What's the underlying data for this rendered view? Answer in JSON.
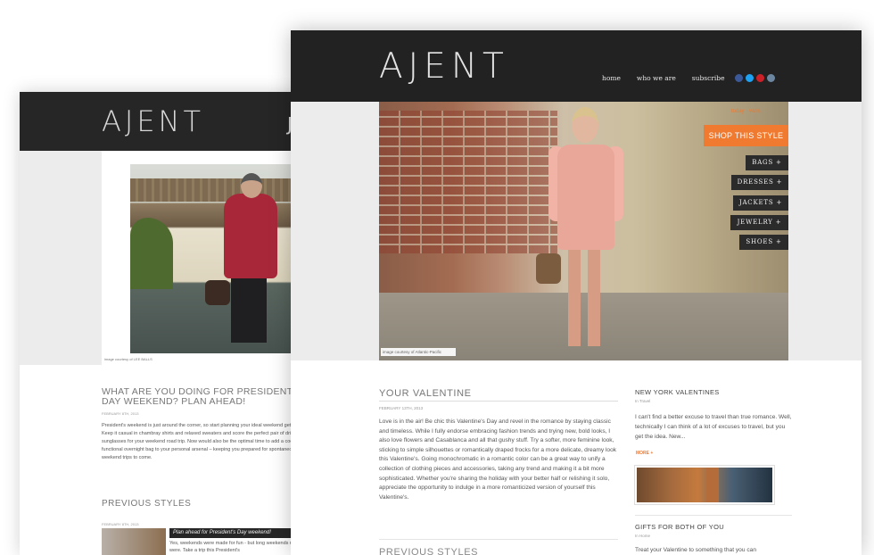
{
  "back_window": {
    "logo": "AJENT",
    "logo_tail": "J",
    "photo_credit": "image courtesy of LEE BALLS",
    "post": {
      "title": "WHAT ARE YOU DOING FOR PRESIDENT'S DAY WEEKEND? PLAN AHEAD!",
      "date": "FEBRUARY 8TH, 2013",
      "body": "President's weekend is just around the corner, so start planning your ideal weekend getaway. Keep it casual in chambray shirts and relaxed sweaters and score the perfect pair of driving sunglasses for your weekend road trip. Now would also be the optimal time to add a cool but functional overnight bag to your personal arsenal – keeping you prepared for spontaneous weekend trips to come."
    },
    "previous_styles": {
      "heading": "PREVIOUS STYLES",
      "date": "FEBRUARY 8TH, 2013",
      "item_title": "Plan ahead for President's Day weekend!",
      "item_body": "Yes, weekends were made for fun - but long weekends really were. Take a trip this President's"
    }
  },
  "front_window": {
    "logo": "AJENT",
    "nav": [
      "home",
      "who we are",
      "subscribe"
    ],
    "social_colors": [
      "#3b5998",
      "#1da1f2",
      "#cb2027",
      "#6c86a0"
    ],
    "hero": {
      "links": "today  ·  vans",
      "shop_button": "SHOP THIS STYLE",
      "categories": [
        "BAGS +",
        "DRESSES +",
        "JACKETS +",
        "JEWELRY +",
        "SHOES +"
      ],
      "credit": "image courtesy of Atlantic-Pacific"
    },
    "post": {
      "title": "YOUR VALENTINE",
      "date": "FEBRUARY 13TH, 2013",
      "body": "Love is in the air! Be chic this Valentine's Day and revel in the romance by staying classic and timeless. While I fully endorse embracing fashion trends and trying new, bold looks, I also love flowers and Casablanca and all that gushy stuff. Try a softer, more feminine look, sticking to simple silhouettes or romantically draped frocks for a more delicate, dreamy look this Valentine's. Going monochromatic in a romantic color can be a great way to unify a collection of clothing pieces and accessories, taking any trend and making it a bit more sophisticated. Whether you're sharing the holiday with your better half or relishing it solo, appreciate the opportunity to indulge in a more romanticized version of yourself this Valentine's."
    },
    "previous_styles_heading": "PREVIOUS STYLES",
    "sidebar": [
      {
        "title": "NEW YORK VALENTINES",
        "meta": "In Travel",
        "body": "I can't find a better excuse to travel than true romance. Well, technically I can think of a lot of excuses to travel, but you get the idea. New...",
        "more": "MORE +"
      },
      {
        "title": "GIFTS FOR BOTH OF YOU",
        "meta": "In Home",
        "body": "Treat your Valentine to something that you can"
      }
    ],
    "accent_color": "#f07a2f"
  }
}
